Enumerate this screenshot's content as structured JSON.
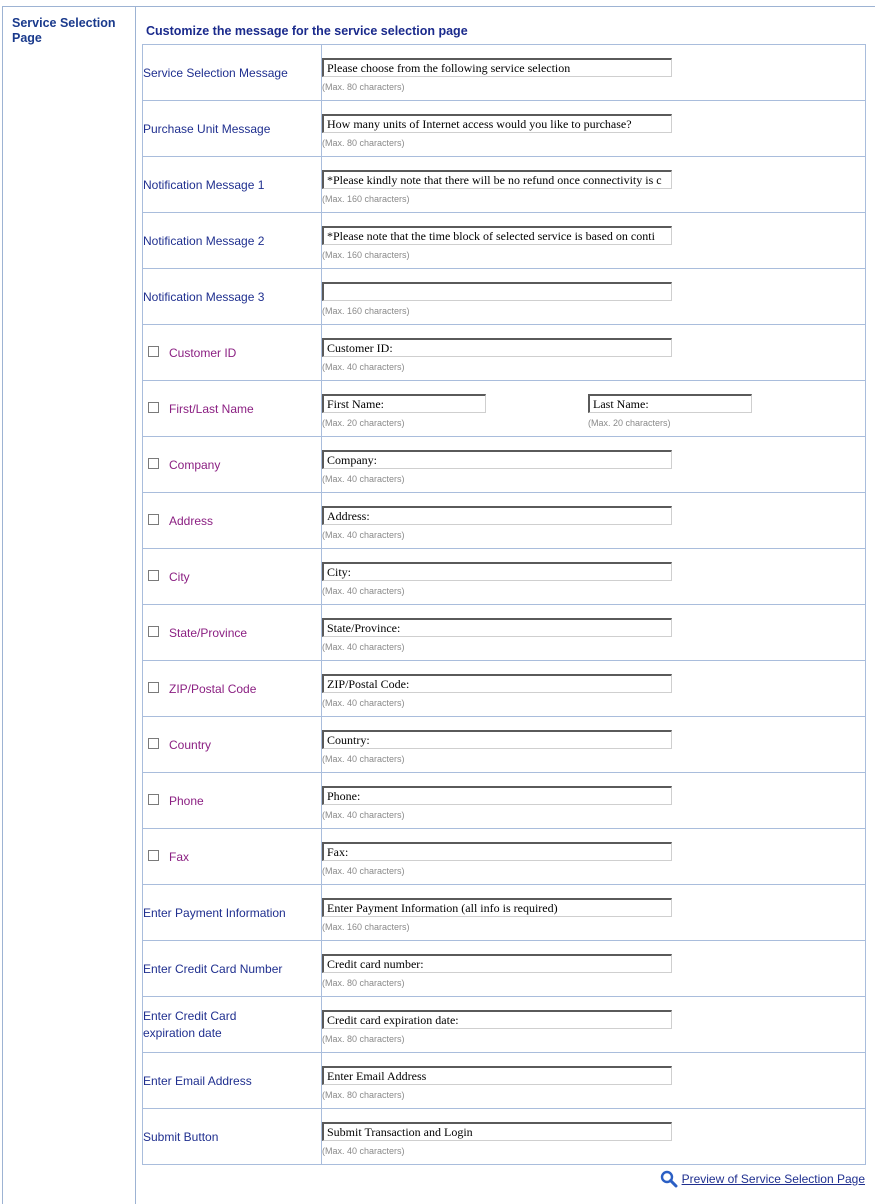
{
  "sidebar": {
    "title": "Service Selection Page"
  },
  "section_title": "Customize the message for the service selection page",
  "rows": [
    {
      "label": "Service Selection Message",
      "value": "Please choose from the following service selection",
      "hint": "(Max. 80 characters)"
    },
    {
      "label": "Purchase Unit Message",
      "value": "How many units of Internet access would you like to purchase?",
      "hint": "(Max. 80 characters)"
    },
    {
      "label": "Notification Message 1",
      "value": "*Please kindly note that there will be no refund once connectivity is c",
      "hint": "(Max. 160 characters)"
    },
    {
      "label": "Notification Message 2",
      "value": "*Please note that the time block of selected service is based on conti",
      "hint": "(Max. 160 characters)"
    },
    {
      "label": "Notification Message 3",
      "value": "",
      "hint": "(Max. 160 characters)"
    },
    {
      "label": "Customer ID",
      "value": "Customer ID:",
      "hint": "(Max. 40 characters)"
    },
    {
      "label": "First/Last Name",
      "first_value": "First Name:",
      "first_hint": "(Max. 20 characters)",
      "last_value": "Last Name:",
      "last_hint": "(Max. 20 characters)"
    },
    {
      "label": "Company",
      "value": "Company:",
      "hint": "(Max. 40 characters)"
    },
    {
      "label": "Address",
      "value": "Address:",
      "hint": "(Max. 40 characters)"
    },
    {
      "label": "City",
      "value": "City:",
      "hint": "(Max. 40 characters)"
    },
    {
      "label": "State/Province",
      "value": "State/Province:",
      "hint": "(Max. 40 characters)"
    },
    {
      "label": "ZIP/Postal Code",
      "value": "ZIP/Postal Code:",
      "hint": "(Max. 40 characters)"
    },
    {
      "label": "Country",
      "value": "Country:",
      "hint": "(Max. 40 characters)"
    },
    {
      "label": "Phone",
      "value": "Phone:",
      "hint": "(Max. 40 characters)"
    },
    {
      "label": "Fax",
      "value": "Fax:",
      "hint": "(Max. 40 characters)"
    },
    {
      "label": "Enter Payment Information",
      "value": "Enter Payment Information (all info is required)",
      "hint": "(Max. 160 characters)"
    },
    {
      "label": "Enter Credit Card Number",
      "value": "Credit card number:",
      "hint": "(Max. 80 characters)"
    },
    {
      "label": "Enter Credit Card expiration date",
      "value": "Credit card expiration date:",
      "hint": "(Max. 80 characters)"
    },
    {
      "label": "Enter Email Address",
      "value": "Enter Email Address",
      "hint": "(Max. 80 characters)"
    },
    {
      "label": "Submit Button",
      "value": "Submit Transaction and Login",
      "hint": "(Max. 40 characters)"
    }
  ],
  "preview_link": "Preview of Service Selection Page",
  "colors": {
    "label": "#1f2f8f",
    "optional_label": "#8b1f82",
    "border": "#a9bddc",
    "hint": "#8a8a8a"
  },
  "icons": {
    "checkbox": "checkbox-icon",
    "preview": "magnifier-icon"
  }
}
